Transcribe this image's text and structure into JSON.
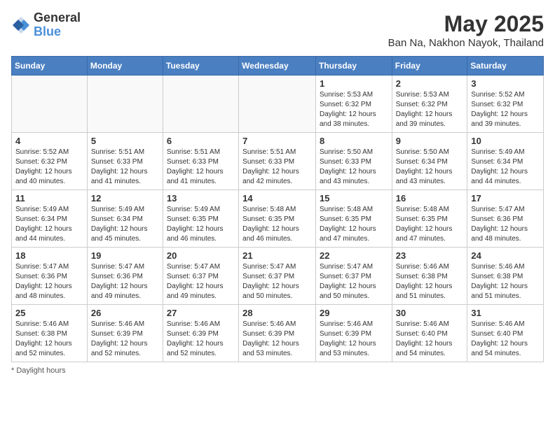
{
  "header": {
    "logo_general": "General",
    "logo_blue": "Blue",
    "month_title": "May 2025",
    "location": "Ban Na, Nakhon Nayok, Thailand"
  },
  "days_of_week": [
    "Sunday",
    "Monday",
    "Tuesday",
    "Wednesday",
    "Thursday",
    "Friday",
    "Saturday"
  ],
  "footer": {
    "label": "Daylight hours"
  },
  "weeks": [
    {
      "days": [
        {
          "num": "",
          "info": ""
        },
        {
          "num": "",
          "info": ""
        },
        {
          "num": "",
          "info": ""
        },
        {
          "num": "",
          "info": ""
        },
        {
          "num": "1",
          "info": "Sunrise: 5:53 AM\nSunset: 6:32 PM\nDaylight: 12 hours and 38 minutes."
        },
        {
          "num": "2",
          "info": "Sunrise: 5:53 AM\nSunset: 6:32 PM\nDaylight: 12 hours and 39 minutes."
        },
        {
          "num": "3",
          "info": "Sunrise: 5:52 AM\nSunset: 6:32 PM\nDaylight: 12 hours and 39 minutes."
        }
      ]
    },
    {
      "days": [
        {
          "num": "4",
          "info": "Sunrise: 5:52 AM\nSunset: 6:32 PM\nDaylight: 12 hours and 40 minutes."
        },
        {
          "num": "5",
          "info": "Sunrise: 5:51 AM\nSunset: 6:33 PM\nDaylight: 12 hours and 41 minutes."
        },
        {
          "num": "6",
          "info": "Sunrise: 5:51 AM\nSunset: 6:33 PM\nDaylight: 12 hours and 41 minutes."
        },
        {
          "num": "7",
          "info": "Sunrise: 5:51 AM\nSunset: 6:33 PM\nDaylight: 12 hours and 42 minutes."
        },
        {
          "num": "8",
          "info": "Sunrise: 5:50 AM\nSunset: 6:33 PM\nDaylight: 12 hours and 43 minutes."
        },
        {
          "num": "9",
          "info": "Sunrise: 5:50 AM\nSunset: 6:34 PM\nDaylight: 12 hours and 43 minutes."
        },
        {
          "num": "10",
          "info": "Sunrise: 5:49 AM\nSunset: 6:34 PM\nDaylight: 12 hours and 44 minutes."
        }
      ]
    },
    {
      "days": [
        {
          "num": "11",
          "info": "Sunrise: 5:49 AM\nSunset: 6:34 PM\nDaylight: 12 hours and 44 minutes."
        },
        {
          "num": "12",
          "info": "Sunrise: 5:49 AM\nSunset: 6:34 PM\nDaylight: 12 hours and 45 minutes."
        },
        {
          "num": "13",
          "info": "Sunrise: 5:49 AM\nSunset: 6:35 PM\nDaylight: 12 hours and 46 minutes."
        },
        {
          "num": "14",
          "info": "Sunrise: 5:48 AM\nSunset: 6:35 PM\nDaylight: 12 hours and 46 minutes."
        },
        {
          "num": "15",
          "info": "Sunrise: 5:48 AM\nSunset: 6:35 PM\nDaylight: 12 hours and 47 minutes."
        },
        {
          "num": "16",
          "info": "Sunrise: 5:48 AM\nSunset: 6:35 PM\nDaylight: 12 hours and 47 minutes."
        },
        {
          "num": "17",
          "info": "Sunrise: 5:47 AM\nSunset: 6:36 PM\nDaylight: 12 hours and 48 minutes."
        }
      ]
    },
    {
      "days": [
        {
          "num": "18",
          "info": "Sunrise: 5:47 AM\nSunset: 6:36 PM\nDaylight: 12 hours and 48 minutes."
        },
        {
          "num": "19",
          "info": "Sunrise: 5:47 AM\nSunset: 6:36 PM\nDaylight: 12 hours and 49 minutes."
        },
        {
          "num": "20",
          "info": "Sunrise: 5:47 AM\nSunset: 6:37 PM\nDaylight: 12 hours and 49 minutes."
        },
        {
          "num": "21",
          "info": "Sunrise: 5:47 AM\nSunset: 6:37 PM\nDaylight: 12 hours and 50 minutes."
        },
        {
          "num": "22",
          "info": "Sunrise: 5:47 AM\nSunset: 6:37 PM\nDaylight: 12 hours and 50 minutes."
        },
        {
          "num": "23",
          "info": "Sunrise: 5:46 AM\nSunset: 6:38 PM\nDaylight: 12 hours and 51 minutes."
        },
        {
          "num": "24",
          "info": "Sunrise: 5:46 AM\nSunset: 6:38 PM\nDaylight: 12 hours and 51 minutes."
        }
      ]
    },
    {
      "days": [
        {
          "num": "25",
          "info": "Sunrise: 5:46 AM\nSunset: 6:38 PM\nDaylight: 12 hours and 52 minutes."
        },
        {
          "num": "26",
          "info": "Sunrise: 5:46 AM\nSunset: 6:39 PM\nDaylight: 12 hours and 52 minutes."
        },
        {
          "num": "27",
          "info": "Sunrise: 5:46 AM\nSunset: 6:39 PM\nDaylight: 12 hours and 52 minutes."
        },
        {
          "num": "28",
          "info": "Sunrise: 5:46 AM\nSunset: 6:39 PM\nDaylight: 12 hours and 53 minutes."
        },
        {
          "num": "29",
          "info": "Sunrise: 5:46 AM\nSunset: 6:39 PM\nDaylight: 12 hours and 53 minutes."
        },
        {
          "num": "30",
          "info": "Sunrise: 5:46 AM\nSunset: 6:40 PM\nDaylight: 12 hours and 54 minutes."
        },
        {
          "num": "31",
          "info": "Sunrise: 5:46 AM\nSunset: 6:40 PM\nDaylight: 12 hours and 54 minutes."
        }
      ]
    }
  ]
}
